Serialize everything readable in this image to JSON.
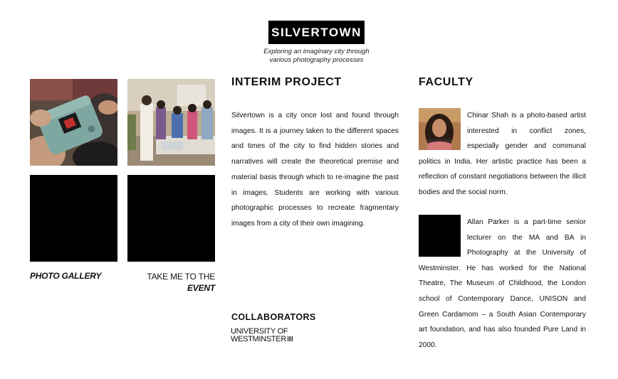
{
  "header": {
    "logo_text": "SILVERTOWN",
    "tagline_line1": "Exploring an imaginary city through",
    "tagline_line2": "various photography processes"
  },
  "gallery": {
    "tiles": [
      {
        "name": "camera-photo",
        "kind": "photo"
      },
      {
        "name": "workshop-photo",
        "kind": "photo"
      },
      {
        "name": "black-tile-1",
        "kind": "black"
      },
      {
        "name": "black-tile-2",
        "kind": "black"
      }
    ],
    "photo_gallery_label": "PHOTO GALLERY",
    "event_line1": "TAKE ME TO THE",
    "event_line2": "EVENT"
  },
  "interim": {
    "title": "INTERIM PROJECT",
    "body": "Silvertown is a city once lost and found through images. It is a journey taken to the different spaces and times of the city to find hidden stories and narratives will create the theoretical premise and material basis through which to re-imagine the past in images. Students are working with various photographic processes to recreate fragmentary images from a city of their own imagining."
  },
  "collaborators": {
    "title": "COLLABORATORS",
    "line1": "UNIVERSITY OF",
    "line2": "WESTMINSTER"
  },
  "faculty": {
    "title": "FACULTY",
    "members": [
      {
        "bio": "Chinar Shah is a photo-based artist interested in conflict zones, especially gender and communal politics in India. Her artistic practice has been a reflection of constant negotiations between the illicit bodies and the social norm."
      },
      {
        "bio": "Allan Parker is a part-time senior lecturer on the MA and BA in Photography at the University of Westminster. He has worked for the National Theatre, The Museum of Childhood, the London school of Contemporary Dance, UNISON and Green Cardamom – a South Asian Contemporary art foundation, and has also founded Pure Land in 2000."
      }
    ]
  },
  "colors": {
    "background": "#ffffff",
    "text": "#111111",
    "logo_bg": "#000000"
  }
}
